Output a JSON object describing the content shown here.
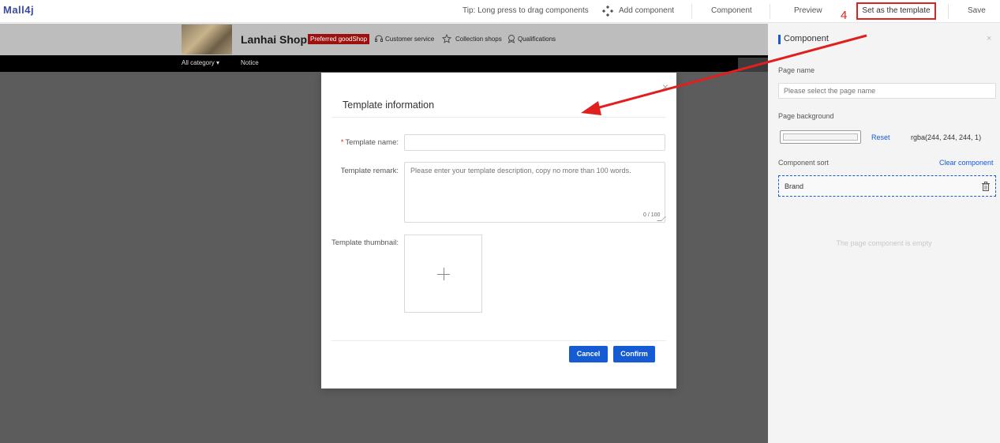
{
  "app": {
    "logo": "Mall4j"
  },
  "toolbar": {
    "tip": "Tip: Long press to drag components",
    "add_component": "Add component",
    "component": "Component",
    "preview": "Preview",
    "set_template": "Set as the template",
    "save": "Save"
  },
  "annotation": {
    "step": "4",
    "color": "#e0201f"
  },
  "shop": {
    "name": "Lanhai Shop",
    "badge": "Preferred goodShop",
    "customer_service": "Customer service",
    "collection": "Collection shops",
    "qualifications": "Qualifications",
    "nav": {
      "category": "All category",
      "notice": "Notice"
    }
  },
  "modal": {
    "close": "×",
    "title": "Template information",
    "name_label": "Template name:",
    "name_required": "*",
    "name_value": "",
    "remark_label": "Template remark:",
    "remark_placeholder": "Please enter your template description, copy no more than 100 words.",
    "counter": "0 / 100",
    "thumbnail_label": "Template thumbnail:",
    "cancel": "Cancel",
    "confirm": "Confirm"
  },
  "panel": {
    "title": "Component",
    "close": "×",
    "page_name_label": "Page name",
    "page_name_placeholder": "Please select the page name",
    "bg_label": "Page background",
    "reset": "Reset",
    "bg_value": "rgba(244, 244, 244, 1)",
    "sort_label": "Component sort",
    "clear": "Clear component",
    "sort_items": [
      {
        "label": "Brand"
      }
    ],
    "empty_text": "The page component is empty"
  },
  "colors": {
    "accent": "#155bd4",
    "highlight": "#e0201f"
  }
}
